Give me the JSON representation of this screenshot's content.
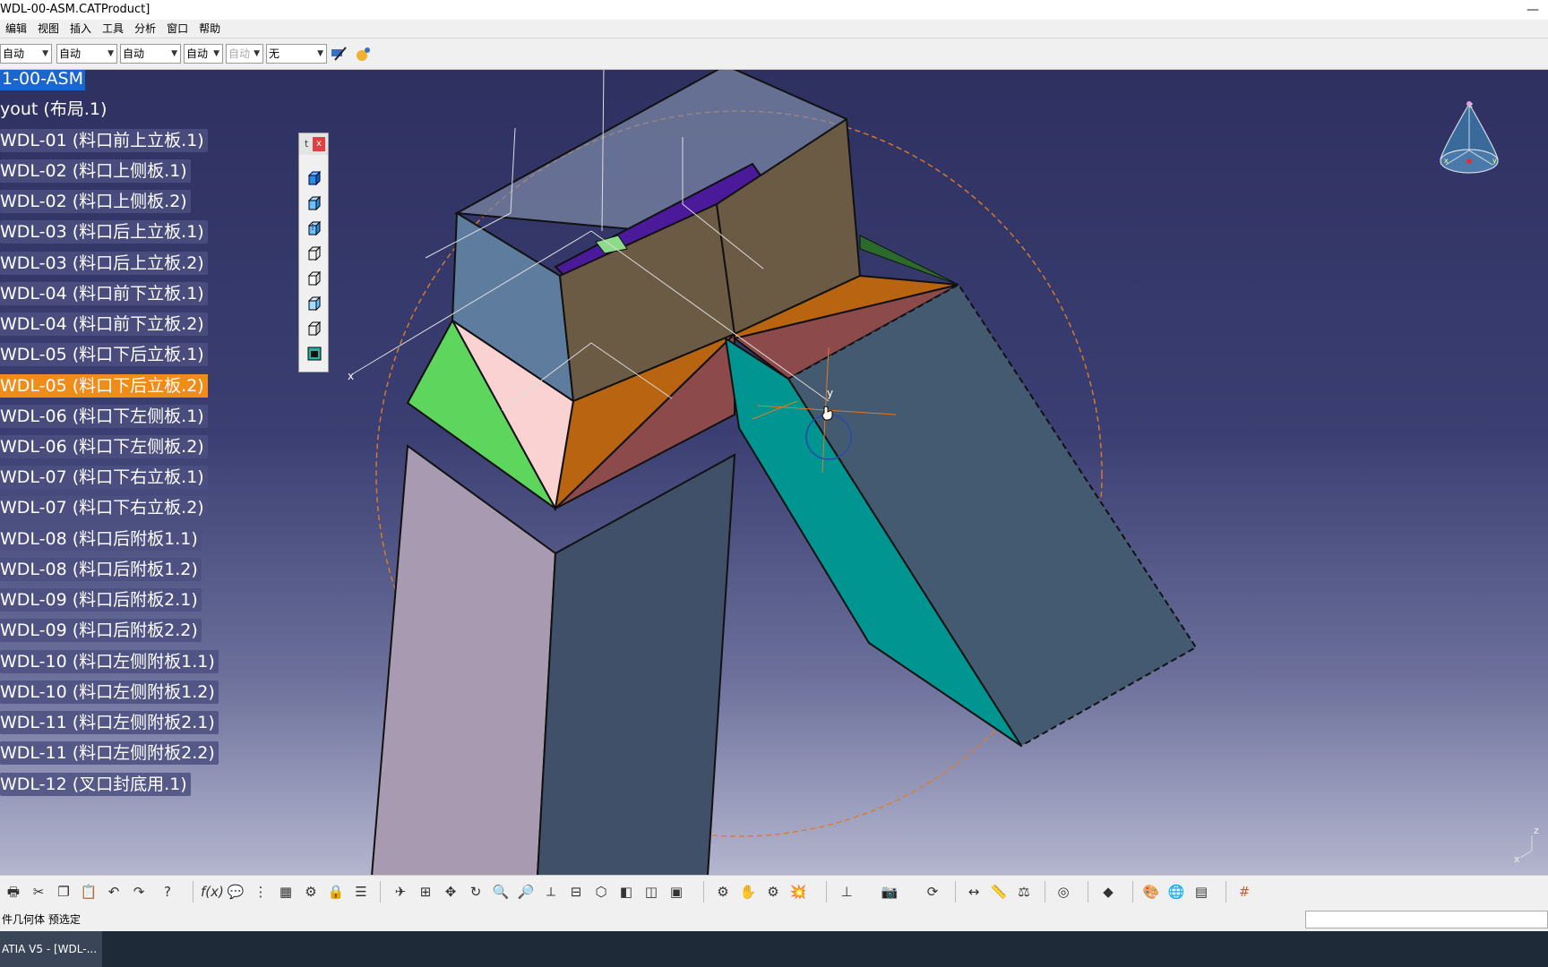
{
  "window": {
    "title": "WDL-00-ASM.CATProduct]"
  },
  "menu": {
    "items": [
      "编辑",
      "视图",
      "插入",
      "工具",
      "分析",
      "窗口",
      "帮助"
    ]
  },
  "toolbar": {
    "combos": [
      {
        "value": "自动"
      },
      {
        "value": "自动"
      },
      {
        "value": "自动"
      },
      {
        "value": "自动"
      },
      {
        "value": "自动"
      },
      {
        "value": "无"
      }
    ]
  },
  "tree": {
    "root": "1-00-ASM",
    "items": [
      "yout (布局.1)",
      "WDL-01 (料口前上立板.1)",
      "WDL-02 (料口上侧板.1)",
      "WDL-02 (料口上侧板.2)",
      "WDL-03 (料口后上立板.1)",
      "WDL-03 (料口后上立板.2)",
      "WDL-04 (料口前下立板.1)",
      "WDL-04 (料口前下立板.2)",
      "WDL-05 (料口下后立板.1)",
      "WDL-05 (料口下后立板.2)",
      "WDL-06 (料口下左侧板.1)",
      "WDL-06 (料口下左侧板.2)",
      "WDL-07 (料口下右立板.1)",
      "WDL-07 (料口下右立板.2)",
      "WDL-08 (料口后附板1.1)",
      "WDL-08 (料口后附板1.2)",
      "WDL-09 (料口后附板2.1)",
      "WDL-09 (料口后附板2.2)",
      "WDL-10 (料口左侧附板1.1)",
      "WDL-10 (料口左侧附板1.2)",
      "WDL-11 (料口左侧附板2.1)",
      "WDL-11 (料口左侧附板2.2)",
      "WDL-12 (叉口封底用.1)"
    ],
    "selected_index": 9
  },
  "floating_toolbar": {
    "title": "t",
    "close": "x"
  },
  "compass": {
    "x_label": "x",
    "y_label": "y",
    "z_label": "z"
  },
  "viewport_labels": {
    "axis_x": "x",
    "axis_y": "y",
    "corner_z": "z",
    "corner_x": "x"
  },
  "status": {
    "text": "件几何体 预选定"
  },
  "taskbar": {
    "item": "ATIA V5 - [WDL-..."
  },
  "colors": {
    "selection_orange": "#f08c1a",
    "root_highlight": "#1a66cc",
    "viewport_top": "#2e3160",
    "teal_panel": "#009590",
    "brown_panel": "#6b5a44",
    "green_panel": "#5ed65e",
    "pink_panel": "#fbd2d2"
  }
}
